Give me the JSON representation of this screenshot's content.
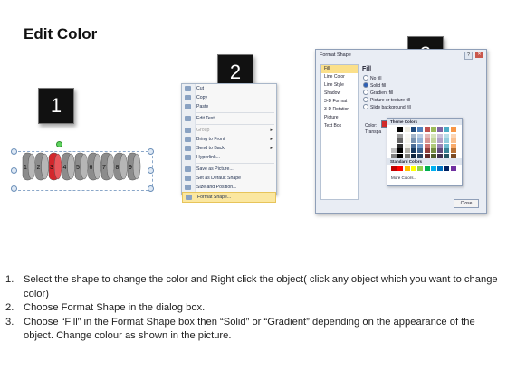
{
  "title": "Edit Color",
  "badges": [
    "1",
    "2",
    "3"
  ],
  "step1": {
    "coins": [
      "1",
      "2",
      "3",
      "4",
      "5",
      "6",
      "7",
      "8",
      "9"
    ],
    "colors": {
      "coin": "#8c8c8c",
      "selected": "#d3272c"
    }
  },
  "context_menu": {
    "items": [
      {
        "label": "Cut",
        "icon": "scissors-icon"
      },
      {
        "label": "Copy",
        "icon": "copy-icon"
      },
      {
        "label": "Paste",
        "icon": "paste-icon"
      },
      {
        "label": "Edit Text",
        "icon": "edit-text-icon"
      },
      {
        "label": "Group",
        "icon": "group-icon"
      },
      {
        "label": "Bring to Front",
        "icon": "bring-front-icon"
      },
      {
        "label": "Send to Back",
        "icon": "send-back-icon"
      },
      {
        "label": "Hyperlink...",
        "icon": "hyperlink-icon"
      },
      {
        "label": "Save as Picture...",
        "icon": "save-picture-icon"
      },
      {
        "label": "Set as Default Shape",
        "icon": "default-shape-icon"
      },
      {
        "label": "Size and Position...",
        "icon": "size-position-icon"
      },
      {
        "label": "Format Shape...",
        "icon": "format-shape-icon"
      }
    ]
  },
  "dialog": {
    "title": "Format Shape",
    "nav": [
      "Fill",
      "Line Color",
      "Line Style",
      "Shadow",
      "3-D Format",
      "3-D Rotation",
      "Picture",
      "Text Box"
    ],
    "section_title": "Fill",
    "options": [
      "No fill",
      "Solid fill",
      "Gradient fill",
      "Picture or texture fill",
      "Slide background fill"
    ],
    "color_label": "Color:",
    "transparency_label": "Transpa",
    "theme_colors_label": "Theme Colors",
    "standard_colors_label": "Standard Colors",
    "more_colors_label": "More Colors...",
    "close_label": "Close",
    "colors": {
      "selected_color": "#d32b2b",
      "theme_top": [
        "#ffffff",
        "#000000",
        "#eeece1",
        "#1f497d",
        "#4f81bd",
        "#c0504d",
        "#9bbb59",
        "#8064a2",
        "#4bacc6",
        "#f79646"
      ],
      "standard": [
        "#c00000",
        "#ff0000",
        "#ffc000",
        "#ffff00",
        "#92d050",
        "#00b050",
        "#00b0f0",
        "#0070c0",
        "#002060",
        "#7030a0"
      ]
    }
  },
  "instructions": [
    {
      "num": "1.",
      "text": "Select the shape to change the color and Right click the object( click any object which you want to change color)"
    },
    {
      "num": "2.",
      "text": "Choose Format Shape in the dialog box."
    },
    {
      "num": "3.",
      "text": "Choose “Fill” in the Format Shape box then “Solid” or “Gradient” depending on the appearance of the object. Change colour as shown in the picture."
    }
  ]
}
